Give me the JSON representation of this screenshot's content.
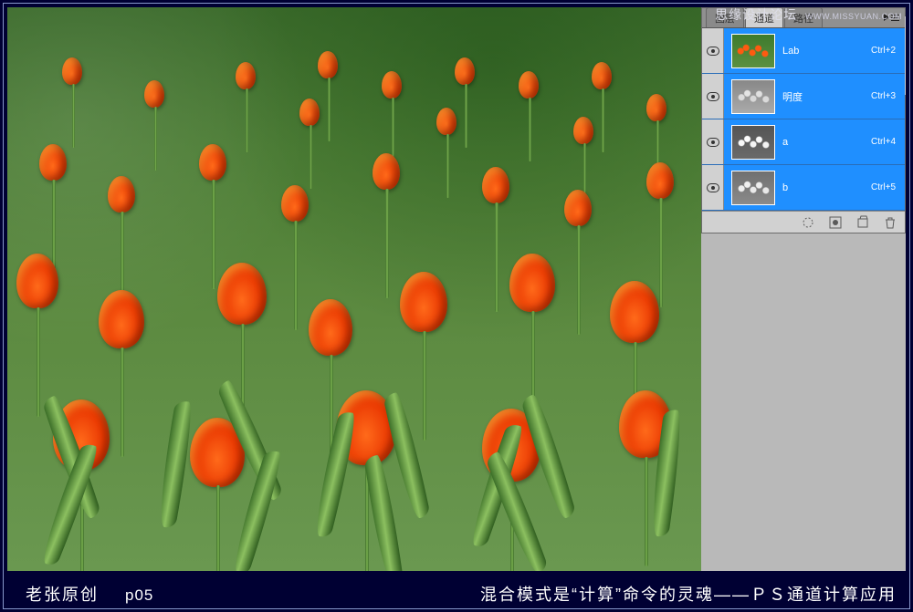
{
  "watermark": {
    "text": "思缘设计论坛",
    "url": "WWW.MISSYUAN.COM"
  },
  "panel": {
    "tabs": {
      "layers": "图层",
      "channels": "通道",
      "paths": "路径"
    },
    "channels": [
      {
        "name": "Lab",
        "shortcut": "Ctrl+2",
        "thumb": "lab"
      },
      {
        "name": "明度",
        "shortcut": "Ctrl+3",
        "thumb": "light"
      },
      {
        "name": "a",
        "shortcut": "Ctrl+4",
        "thumb": "a"
      },
      {
        "name": "b",
        "shortcut": "Ctrl+5",
        "thumb": "b"
      }
    ]
  },
  "caption": {
    "author": "老张原创",
    "page": "p05",
    "title": "混合模式是“计算”命令的灵魂——ＰＳ通道计算应用"
  }
}
